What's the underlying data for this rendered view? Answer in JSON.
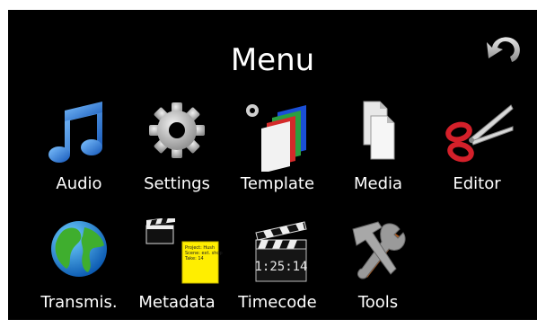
{
  "header": {
    "title": "Menu",
    "back_icon": "undo-arrow-icon"
  },
  "menu": {
    "items": [
      {
        "label": "Audio",
        "icon": "music-note-icon"
      },
      {
        "label": "Settings",
        "icon": "gear-icon"
      },
      {
        "label": "Template",
        "icon": "template-layers-icon"
      },
      {
        "label": "Media",
        "icon": "documents-icon"
      },
      {
        "label": "Editor",
        "icon": "scissors-icon"
      },
      {
        "label": "Transmis.",
        "icon": "globe-icon"
      },
      {
        "label": "Metadata",
        "icon": "clapper-note-icon"
      },
      {
        "label": "Timecode",
        "icon": "clapperboard-timecode-icon"
      },
      {
        "label": "Tools",
        "icon": "hammer-wrench-icon"
      }
    ]
  },
  "metadata_note": {
    "lines": [
      "Project: Hush",
      "Scene: ext. shop",
      "Take: 14"
    ]
  },
  "timecode_display": "1:25:14",
  "colors": {
    "background": "#000000",
    "text": "#ffffff",
    "audio_blue": "#2a7fe0",
    "note_yellow": "#ffee00",
    "scissors_red": "#d4202a"
  }
}
